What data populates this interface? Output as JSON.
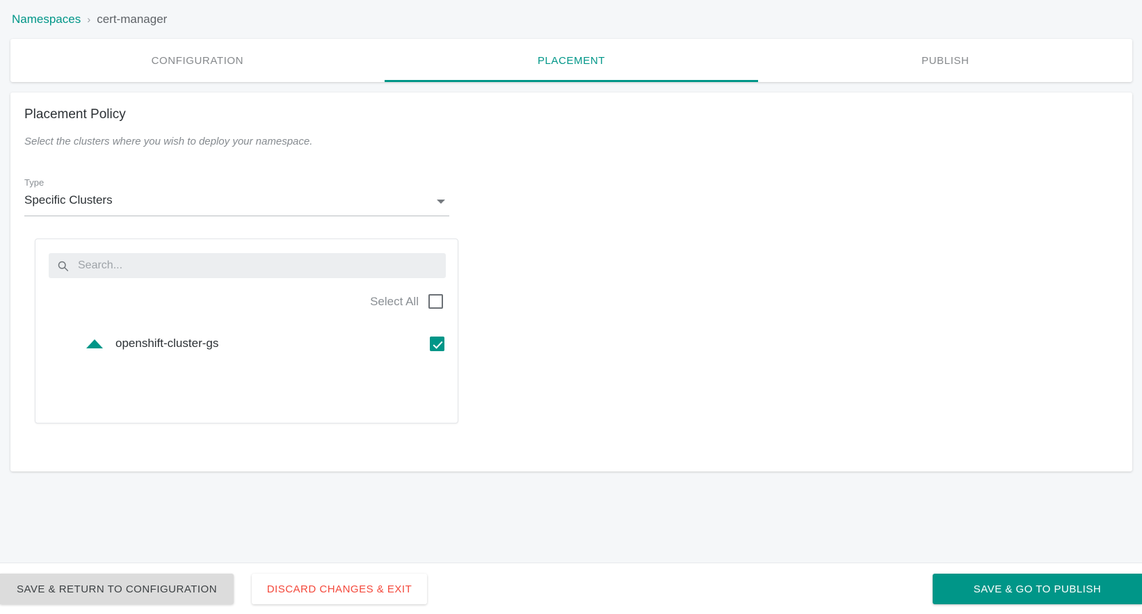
{
  "breadcrumb": {
    "root_label": "Namespaces",
    "separator": "›",
    "current_label": "cert-manager"
  },
  "tabs": [
    {
      "label": "CONFIGURATION",
      "active": false
    },
    {
      "label": "PLACEMENT",
      "active": true
    },
    {
      "label": "PUBLISH",
      "active": false
    }
  ],
  "placement": {
    "title": "Placement Policy",
    "description": "Select the clusters where you wish to deploy your namespace.",
    "type_field": {
      "label": "Type",
      "value": "Specific Clusters"
    },
    "search": {
      "placeholder": "Search...",
      "value": ""
    },
    "select_all": {
      "label": "Select All",
      "checked": false
    },
    "clusters": [
      {
        "name": "openshift-cluster-gs",
        "checked": true,
        "status_icon": "triangle-up-icon"
      }
    ]
  },
  "footer": {
    "save_return_label": "SAVE & RETURN TO CONFIGURATION",
    "discard_label": "DISCARD CHANGES & EXIT",
    "save_publish_label": "SAVE & GO TO PUBLISH"
  },
  "colors": {
    "accent": "#009688",
    "danger": "#f4483b",
    "page_bg": "#f5f7f9",
    "muted_text": "#868b90"
  }
}
